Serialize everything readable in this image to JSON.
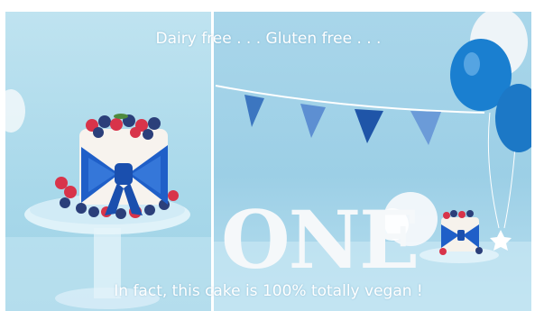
{
  "image": {
    "caption_top": "Dairy free . . . Gluten free . . .",
    "caption_bottom": "In fact, this cake is 100% totally vegan !",
    "letters": "ONE",
    "colors": {
      "backdrop": "#a8d8ea",
      "bow_blue": "#1f5fc8",
      "balloon_blue": "#1a7fd0",
      "balloon_white": "#eef4f8",
      "bunting_blue": "#2a66b8",
      "berry_red": "#d8344a",
      "berry_blue": "#2b3f7a",
      "glass": "#dff1f8"
    }
  }
}
